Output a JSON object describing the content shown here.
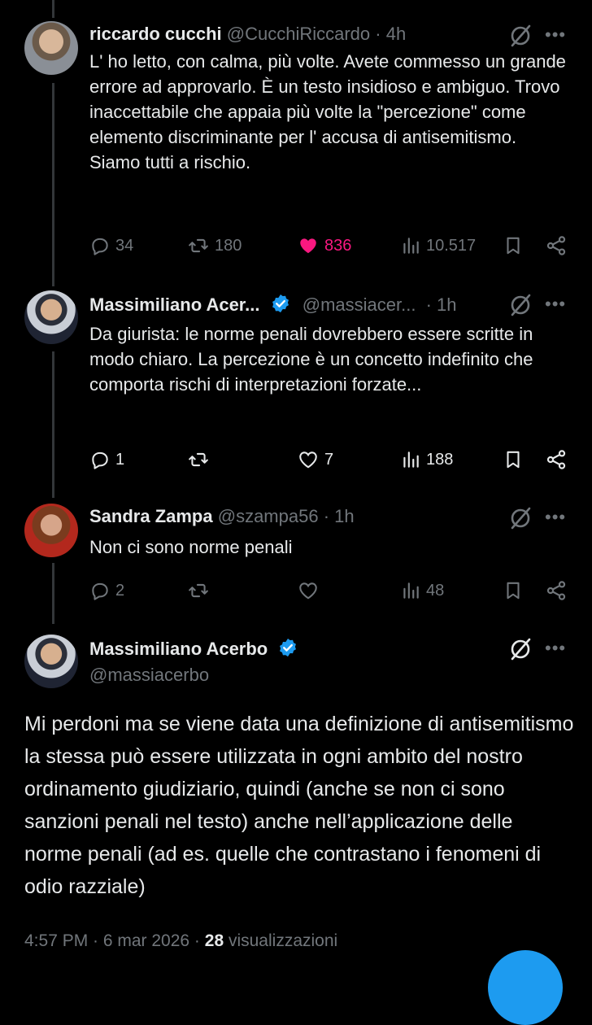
{
  "tweets": [
    {
      "name": "riccardo cucchi",
      "handle": "@CucchiRiccardo",
      "time": "· 4h",
      "text": "L' ho letto, con calma, più volte. Avete commesso un grande errore ad approvarlo. È un testo insidioso e ambiguo. Trovo inaccettabile che appaia più volte la \"percezione\" come elemento discriminante per l' accusa di antisemitismo.\nSiamo tutti a rischio.",
      "replies": "34",
      "reposts": "180",
      "likes": "836",
      "views": "10.517"
    },
    {
      "name": "Massimiliano Acer...",
      "handle": "@massiacer...",
      "time": "· 1h",
      "text": "Da giurista: le norme penali dovrebbero essere scritte in modo chiaro. La percezione è un concetto indefinito che comporta rischi di interpretazioni forzate...",
      "replies": "1",
      "reposts": "",
      "likes": "7",
      "views": "188"
    },
    {
      "name": "Sandra Zampa",
      "handle": "@szampa56",
      "time": "· 1h",
      "text": "Non ci sono norme penali",
      "replies": "2",
      "reposts": "",
      "likes": "",
      "views": "48"
    }
  ],
  "main_tweet": {
    "name": "Massimiliano Acerbo",
    "handle": "@massiacerbo",
    "text": "Mi perdoni ma se viene data una definizione di antisemitismo la stessa può essere utilizzata in ogni ambito del nostro ordinamento giudiziario, quindi (anche se non ci sono sanzioni penali nel testo) anche nell’applicazione delle norme penali (ad es. quelle che contrastano i fenomeni di odio razziale)",
    "timestamp": "4:57 PM · 6 mar 2026 · ",
    "views_count": "28",
    "views_label": " visualizzazioni"
  },
  "more_label": "•••",
  "colors": {
    "accent": "#1d9bf0",
    "like": "#f91880",
    "muted": "#71767b",
    "text": "#e7e9ea"
  },
  "icons": [
    "grok-icon",
    "more-icon",
    "reply-icon",
    "repost-icon",
    "like-icon",
    "views-icon",
    "bookmark-icon",
    "share-icon",
    "verified-badge-icon"
  ]
}
